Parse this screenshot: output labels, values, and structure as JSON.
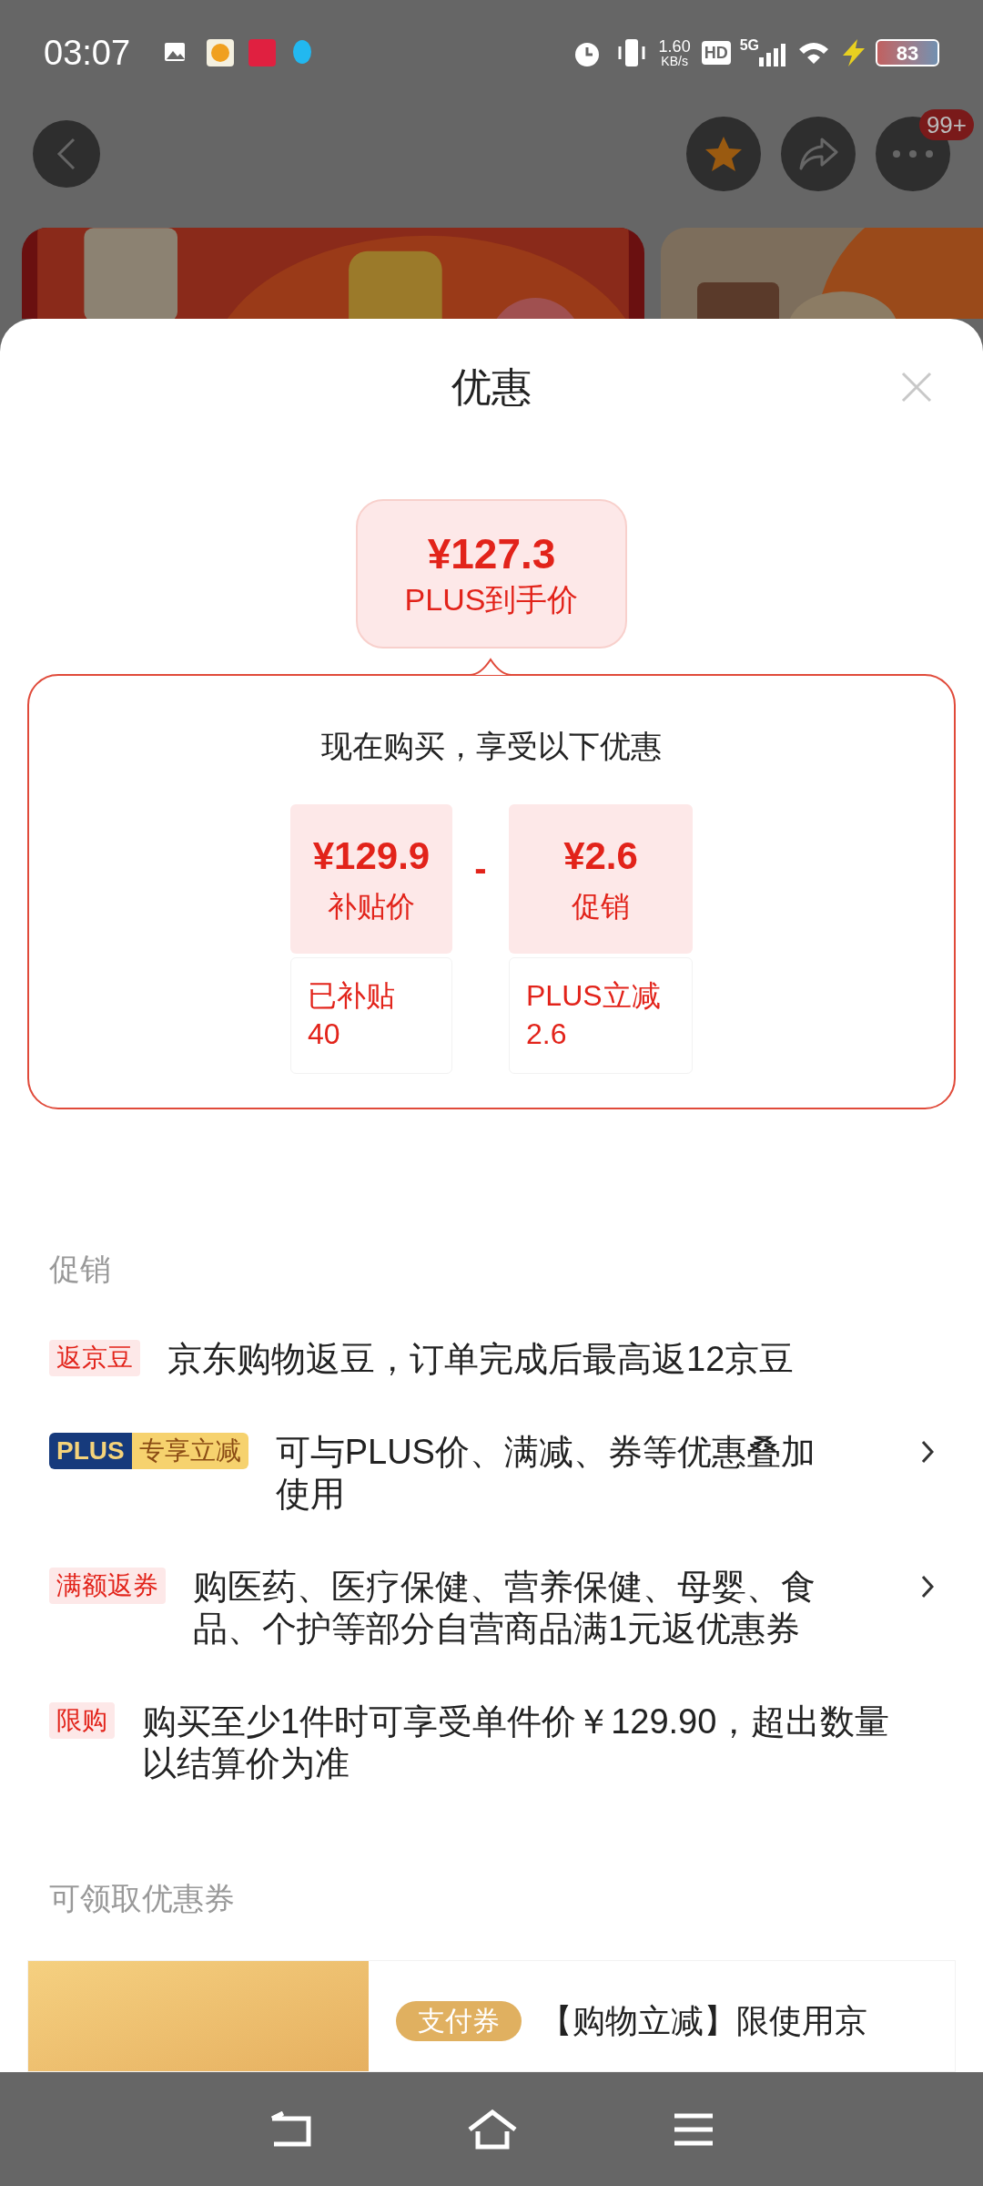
{
  "status_bar": {
    "time": "03:07",
    "net_speed": "1.60",
    "net_unit": "KB/s",
    "hd": "HD",
    "network": "5G",
    "battery": "83"
  },
  "top_bar": {
    "badge": "99+"
  },
  "sheet": {
    "title": "优惠",
    "final_price": {
      "amount": "¥127.3",
      "label": "PLUS到手价"
    },
    "breakdown": {
      "heading": "现在购买，享受以下优惠",
      "operator": "-",
      "items": [
        {
          "amount": "¥129.9",
          "label": "补贴价",
          "detail": "已补贴\n40"
        },
        {
          "amount": "¥2.6",
          "label": "促销",
          "detail": "PLUS立减\n2.6"
        }
      ]
    },
    "promotions": {
      "title": "促销",
      "items": [
        {
          "kind": "tag",
          "tag": "返京豆",
          "text": "京东购物返豆，订单完成后最高返12京豆",
          "has_arrow": false
        },
        {
          "kind": "plus",
          "tag": "PLUS",
          "tag2": "专享立减",
          "text": "可与PLUS价、满减、券等优惠叠加使用",
          "has_arrow": true
        },
        {
          "kind": "tag",
          "tag": "满额返券",
          "text": "购医药、医疗保健、营养保健、母婴、食品、个护等部分自营商品满1元返优惠券",
          "has_arrow": true
        },
        {
          "kind": "tag",
          "tag": "限购",
          "text": "购买至少1件时可享受单件价￥129.90，超出数量以结算价为准",
          "has_arrow": false
        }
      ]
    },
    "coupons": {
      "title": "可领取优惠券",
      "items": [
        {
          "tag": "支付券",
          "text": "【购物立减】限使用京"
        }
      ]
    }
  }
}
